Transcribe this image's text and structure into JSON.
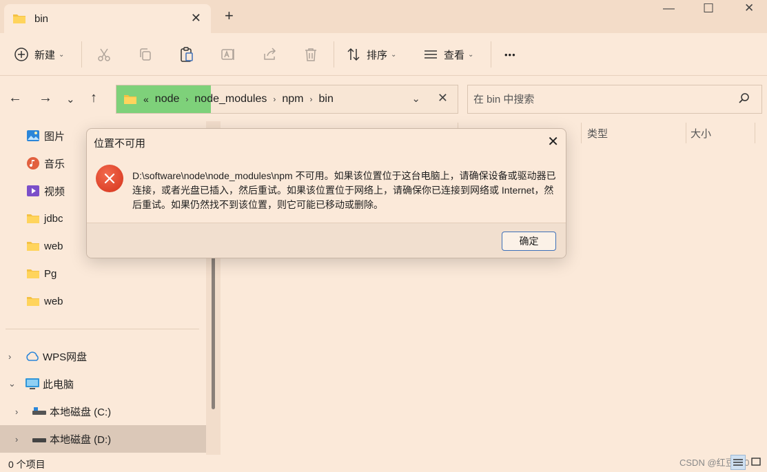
{
  "tab": {
    "title": "bin",
    "close": "✕",
    "new": "+"
  },
  "window": {
    "minimize": "—",
    "maximize": "☐",
    "close": "✕"
  },
  "toolbar": {
    "new_label": "新建",
    "sort_label": "排序",
    "view_label": "查看",
    "more_label": "•••"
  },
  "address": {
    "prefix": "«",
    "crumbs": [
      "node",
      "node_modules",
      "npm",
      "bin"
    ],
    "sep": "›"
  },
  "search": {
    "placeholder": "在 bin 中搜索"
  },
  "sidebar": {
    "items": [
      {
        "label": "图片"
      },
      {
        "label": "音乐"
      },
      {
        "label": "视频"
      },
      {
        "label": "jdbc"
      },
      {
        "label": "web"
      },
      {
        "label": "Pg"
      },
      {
        "label": "web"
      },
      {
        "label": "WPS网盘"
      },
      {
        "label": "此电脑"
      },
      {
        "label": "本地磁盘 (C:)"
      },
      {
        "label": "本地磁盘 (D:)"
      }
    ]
  },
  "columns": {
    "type": "类型",
    "size": "大小"
  },
  "status": {
    "count": "0 个项目"
  },
  "watermark": "CSDN @红豆810",
  "dialog": {
    "title": "位置不可用",
    "message": "D:\\software\\node\\node_modules\\npm 不可用。如果该位置位于这台电脑上，请确保设备或驱动器已连接，或者光盘已插入，然后重试。如果该位置位于网络上，请确保你已连接到网络或 Internet，然后重试。如果仍然找不到该位置，则它可能已移动或删除。",
    "ok_label": "确定",
    "close": "✕"
  }
}
